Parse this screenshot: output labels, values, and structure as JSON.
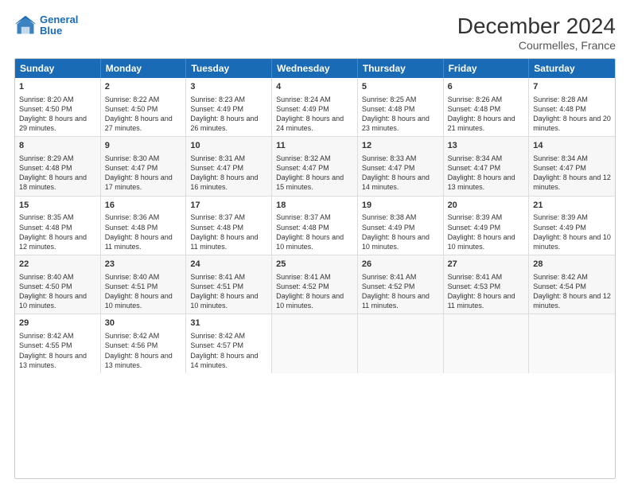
{
  "logo": {
    "line1": "General",
    "line2": "Blue"
  },
  "title": "December 2024",
  "subtitle": "Courmelles, France",
  "days_of_week": [
    "Sunday",
    "Monday",
    "Tuesday",
    "Wednesday",
    "Thursday",
    "Friday",
    "Saturday"
  ],
  "weeks": [
    [
      {
        "day": 1,
        "sunrise": "Sunrise: 8:20 AM",
        "sunset": "Sunset: 4:50 PM",
        "daylight": "Daylight: 8 hours and 29 minutes."
      },
      {
        "day": 2,
        "sunrise": "Sunrise: 8:22 AM",
        "sunset": "Sunset: 4:50 PM",
        "daylight": "Daylight: 8 hours and 27 minutes."
      },
      {
        "day": 3,
        "sunrise": "Sunrise: 8:23 AM",
        "sunset": "Sunset: 4:49 PM",
        "daylight": "Daylight: 8 hours and 26 minutes."
      },
      {
        "day": 4,
        "sunrise": "Sunrise: 8:24 AM",
        "sunset": "Sunset: 4:49 PM",
        "daylight": "Daylight: 8 hours and 24 minutes."
      },
      {
        "day": 5,
        "sunrise": "Sunrise: 8:25 AM",
        "sunset": "Sunset: 4:48 PM",
        "daylight": "Daylight: 8 hours and 23 minutes."
      },
      {
        "day": 6,
        "sunrise": "Sunrise: 8:26 AM",
        "sunset": "Sunset: 4:48 PM",
        "daylight": "Daylight: 8 hours and 21 minutes."
      },
      {
        "day": 7,
        "sunrise": "Sunrise: 8:28 AM",
        "sunset": "Sunset: 4:48 PM",
        "daylight": "Daylight: 8 hours and 20 minutes."
      }
    ],
    [
      {
        "day": 8,
        "sunrise": "Sunrise: 8:29 AM",
        "sunset": "Sunset: 4:48 PM",
        "daylight": "Daylight: 8 hours and 18 minutes."
      },
      {
        "day": 9,
        "sunrise": "Sunrise: 8:30 AM",
        "sunset": "Sunset: 4:47 PM",
        "daylight": "Daylight: 8 hours and 17 minutes."
      },
      {
        "day": 10,
        "sunrise": "Sunrise: 8:31 AM",
        "sunset": "Sunset: 4:47 PM",
        "daylight": "Daylight: 8 hours and 16 minutes."
      },
      {
        "day": 11,
        "sunrise": "Sunrise: 8:32 AM",
        "sunset": "Sunset: 4:47 PM",
        "daylight": "Daylight: 8 hours and 15 minutes."
      },
      {
        "day": 12,
        "sunrise": "Sunrise: 8:33 AM",
        "sunset": "Sunset: 4:47 PM",
        "daylight": "Daylight: 8 hours and 14 minutes."
      },
      {
        "day": 13,
        "sunrise": "Sunrise: 8:34 AM",
        "sunset": "Sunset: 4:47 PM",
        "daylight": "Daylight: 8 hours and 13 minutes."
      },
      {
        "day": 14,
        "sunrise": "Sunrise: 8:34 AM",
        "sunset": "Sunset: 4:47 PM",
        "daylight": "Daylight: 8 hours and 12 minutes."
      }
    ],
    [
      {
        "day": 15,
        "sunrise": "Sunrise: 8:35 AM",
        "sunset": "Sunset: 4:48 PM",
        "daylight": "Daylight: 8 hours and 12 minutes."
      },
      {
        "day": 16,
        "sunrise": "Sunrise: 8:36 AM",
        "sunset": "Sunset: 4:48 PM",
        "daylight": "Daylight: 8 hours and 11 minutes."
      },
      {
        "day": 17,
        "sunrise": "Sunrise: 8:37 AM",
        "sunset": "Sunset: 4:48 PM",
        "daylight": "Daylight: 8 hours and 11 minutes."
      },
      {
        "day": 18,
        "sunrise": "Sunrise: 8:37 AM",
        "sunset": "Sunset: 4:48 PM",
        "daylight": "Daylight: 8 hours and 10 minutes."
      },
      {
        "day": 19,
        "sunrise": "Sunrise: 8:38 AM",
        "sunset": "Sunset: 4:49 PM",
        "daylight": "Daylight: 8 hours and 10 minutes."
      },
      {
        "day": 20,
        "sunrise": "Sunrise: 8:39 AM",
        "sunset": "Sunset: 4:49 PM",
        "daylight": "Daylight: 8 hours and 10 minutes."
      },
      {
        "day": 21,
        "sunrise": "Sunrise: 8:39 AM",
        "sunset": "Sunset: 4:49 PM",
        "daylight": "Daylight: 8 hours and 10 minutes."
      }
    ],
    [
      {
        "day": 22,
        "sunrise": "Sunrise: 8:40 AM",
        "sunset": "Sunset: 4:50 PM",
        "daylight": "Daylight: 8 hours and 10 minutes."
      },
      {
        "day": 23,
        "sunrise": "Sunrise: 8:40 AM",
        "sunset": "Sunset: 4:51 PM",
        "daylight": "Daylight: 8 hours and 10 minutes."
      },
      {
        "day": 24,
        "sunrise": "Sunrise: 8:41 AM",
        "sunset": "Sunset: 4:51 PM",
        "daylight": "Daylight: 8 hours and 10 minutes."
      },
      {
        "day": 25,
        "sunrise": "Sunrise: 8:41 AM",
        "sunset": "Sunset: 4:52 PM",
        "daylight": "Daylight: 8 hours and 10 minutes."
      },
      {
        "day": 26,
        "sunrise": "Sunrise: 8:41 AM",
        "sunset": "Sunset: 4:52 PM",
        "daylight": "Daylight: 8 hours and 11 minutes."
      },
      {
        "day": 27,
        "sunrise": "Sunrise: 8:41 AM",
        "sunset": "Sunset: 4:53 PM",
        "daylight": "Daylight: 8 hours and 11 minutes."
      },
      {
        "day": 28,
        "sunrise": "Sunrise: 8:42 AM",
        "sunset": "Sunset: 4:54 PM",
        "daylight": "Daylight: 8 hours and 12 minutes."
      }
    ],
    [
      {
        "day": 29,
        "sunrise": "Sunrise: 8:42 AM",
        "sunset": "Sunset: 4:55 PM",
        "daylight": "Daylight: 8 hours and 13 minutes."
      },
      {
        "day": 30,
        "sunrise": "Sunrise: 8:42 AM",
        "sunset": "Sunset: 4:56 PM",
        "daylight": "Daylight: 8 hours and 13 minutes."
      },
      {
        "day": 31,
        "sunrise": "Sunrise: 8:42 AM",
        "sunset": "Sunset: 4:57 PM",
        "daylight": "Daylight: 8 hours and 14 minutes."
      },
      null,
      null,
      null,
      null
    ]
  ]
}
